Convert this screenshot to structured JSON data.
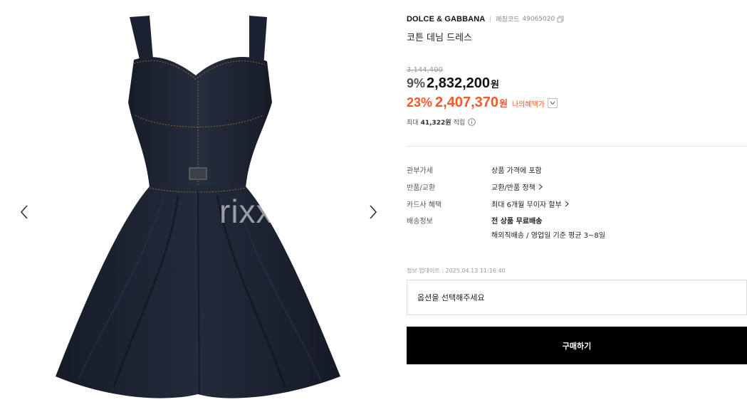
{
  "gallery": {
    "watermark": "rixx",
    "prev_icon": "chevron-left-icon",
    "next_icon": "chevron-right-icon"
  },
  "product": {
    "brand": "DOLCE & GABBANA",
    "code_label": "페칭코드",
    "code_value": "49065020",
    "title": "코튼 데님 드레스",
    "original_price": "3,144,400",
    "discount_rate": "9%",
    "price": "2,832,200",
    "currency": "원",
    "benefit_rate": "23%",
    "benefit_price": "2,407,370",
    "benefit_currency": "원",
    "my_benefit_label": "나의혜택가",
    "points_prefix": "최대",
    "points_value": "41,322원",
    "points_suffix": "적립"
  },
  "specs": [
    {
      "key": "관부가세",
      "value": "상품 가격에 포함"
    },
    {
      "key": "반품/교환",
      "value": "교환/반품 정책"
    },
    {
      "key": "카드사 혜택",
      "value": "최대 6개월 무이자 할부"
    },
    {
      "key": "배송정보",
      "value": "전 상품 무료배송",
      "value2": "해외직배송 / 영업일 기준 평균 3~8일"
    }
  ],
  "updated": "정보 업데이트 : 2025.04.13 11:16:40",
  "option_placeholder": "옵션을 선택해주세요",
  "buy_label": "구매하기",
  "colors": {
    "accent": "#f05a28",
    "buy_button": "#000000",
    "denim": "#1c2230"
  }
}
